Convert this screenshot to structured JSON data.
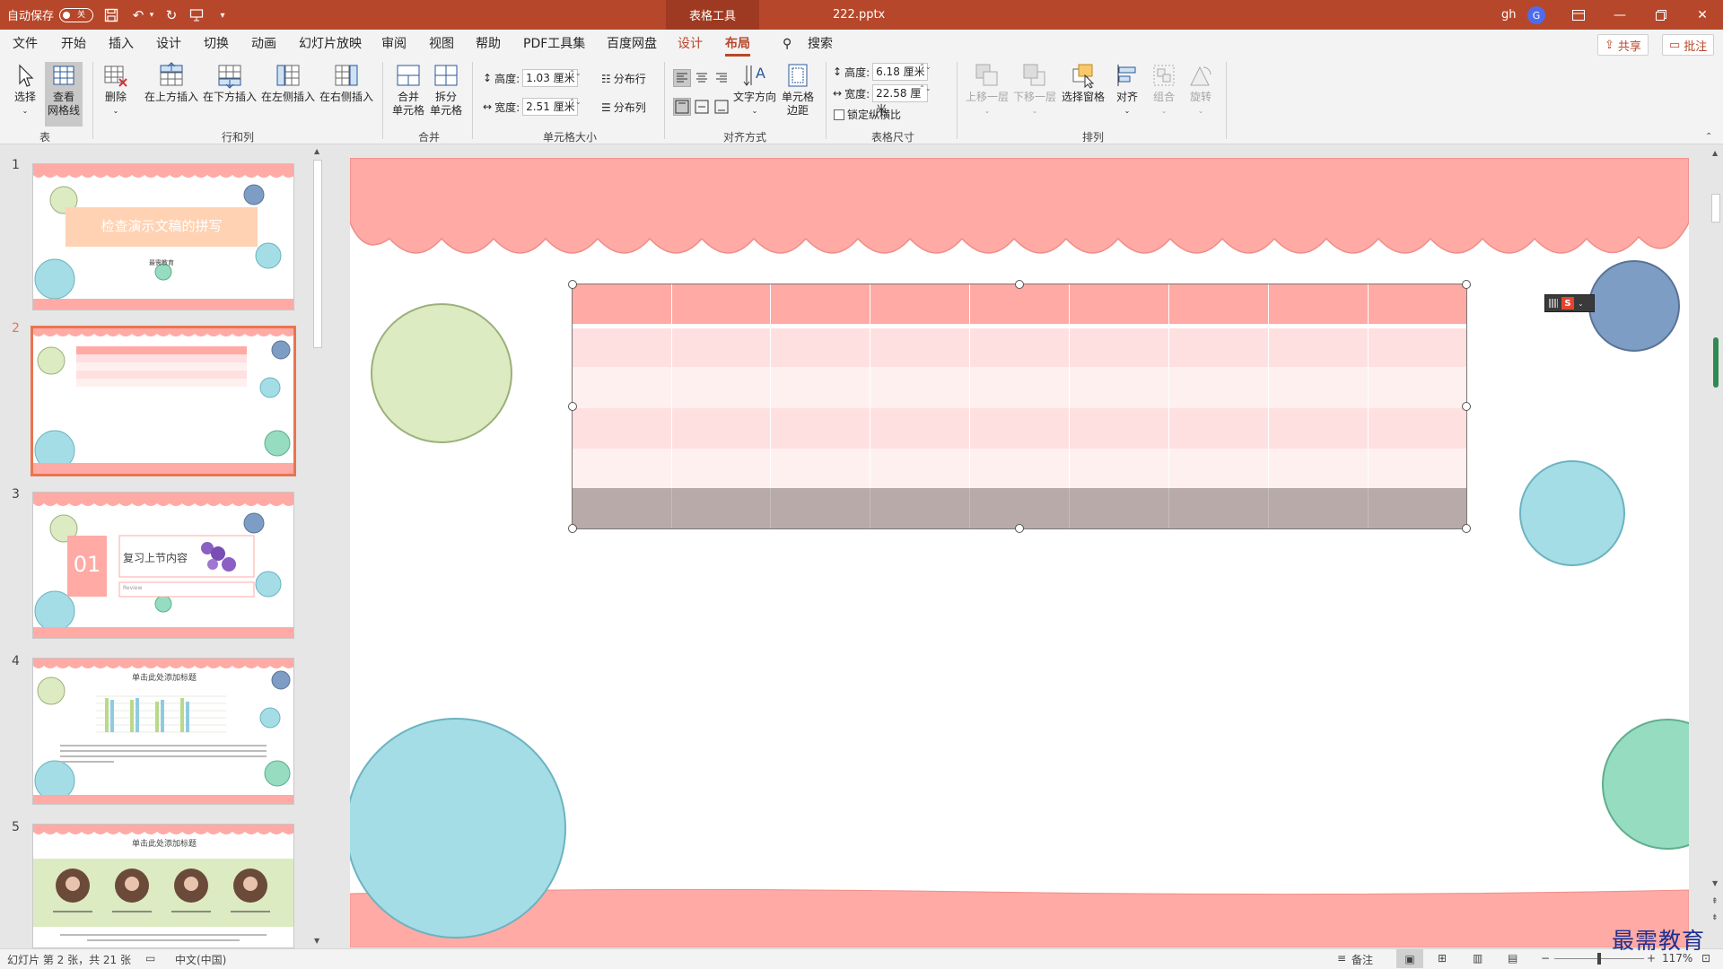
{
  "titlebar": {
    "autosave_label": "自动保存",
    "autosave_state": "关",
    "context_tab": "表格工具",
    "filename": "222.pptx",
    "user": "gh",
    "avatar_letter": "G",
    "color": "#b7472a"
  },
  "menu": {
    "tabs": [
      "文件",
      "开始",
      "插入",
      "设计",
      "切换",
      "动画",
      "幻灯片放映",
      "审阅",
      "视图",
      "帮助",
      "PDF工具集",
      "百度网盘",
      "设计",
      "布局"
    ],
    "search": "搜索",
    "share": "共享",
    "comments": "批注",
    "active_tab": "布局"
  },
  "ribbon": {
    "select": "选择",
    "view_gridlines_1": "查看",
    "view_gridlines_2": "网格线",
    "delete": "删除",
    "insert_above": "在上方插入",
    "insert_below": "在下方插入",
    "insert_left": "在左侧插入",
    "insert_right": "在右侧插入",
    "merge_1": "合并",
    "merge_2": "单元格",
    "split_1": "拆分",
    "split_2": "单元格",
    "height_label": "高度:",
    "height_value": "1.03 厘米",
    "width_label": "宽度:",
    "width_value": "2.51 厘米",
    "distribute_rows": "分布行",
    "distribute_cols": "分布列",
    "text_direction": "文字方向",
    "cell_margins_1": "单元格",
    "cell_margins_2": "边距",
    "table_height_label": "高度:",
    "table_height_value": "6.18 厘米",
    "table_width_label": "宽度:",
    "table_width_value": "22.58 厘米",
    "lock_aspect": "锁定纵横比",
    "bring_forward": "上移一层",
    "send_backward": "下移一层",
    "selection_pane": "选择窗格",
    "align": "对齐",
    "group": "组合",
    "rotate": "旋转",
    "groups": {
      "table": "表",
      "rows_cols": "行和列",
      "merge": "合并",
      "cell_size": "单元格大小",
      "alignment": "对齐方式",
      "table_size": "表格尺寸",
      "arrange": "排列"
    }
  },
  "slides": {
    "numbers": [
      "1",
      "2",
      "3",
      "4",
      "5"
    ],
    "s1_title": "检查演示文稿的拼写",
    "s1_sub": "最需教育",
    "s3_num": "01",
    "s3_title": "复习上节内容",
    "s3_sub": "Review",
    "s4_title": "单击此处添加标题",
    "s5_title": "单击此处添加标题"
  },
  "colors": {
    "pink": "#ffaaa5",
    "pink_light": "#ffe0e0",
    "green": "#dcebc1",
    "blue_dark": "#7e9dc4",
    "cyan": "#a5dde6",
    "mint": "#96dcc0",
    "gray_row": "#b8aaa9"
  },
  "status": {
    "slide_info": "幻灯片 第 2 张，共 21 张",
    "language": "中文(中国)",
    "notes": "备注",
    "zoom": "117%"
  },
  "watermark": "最需教育"
}
